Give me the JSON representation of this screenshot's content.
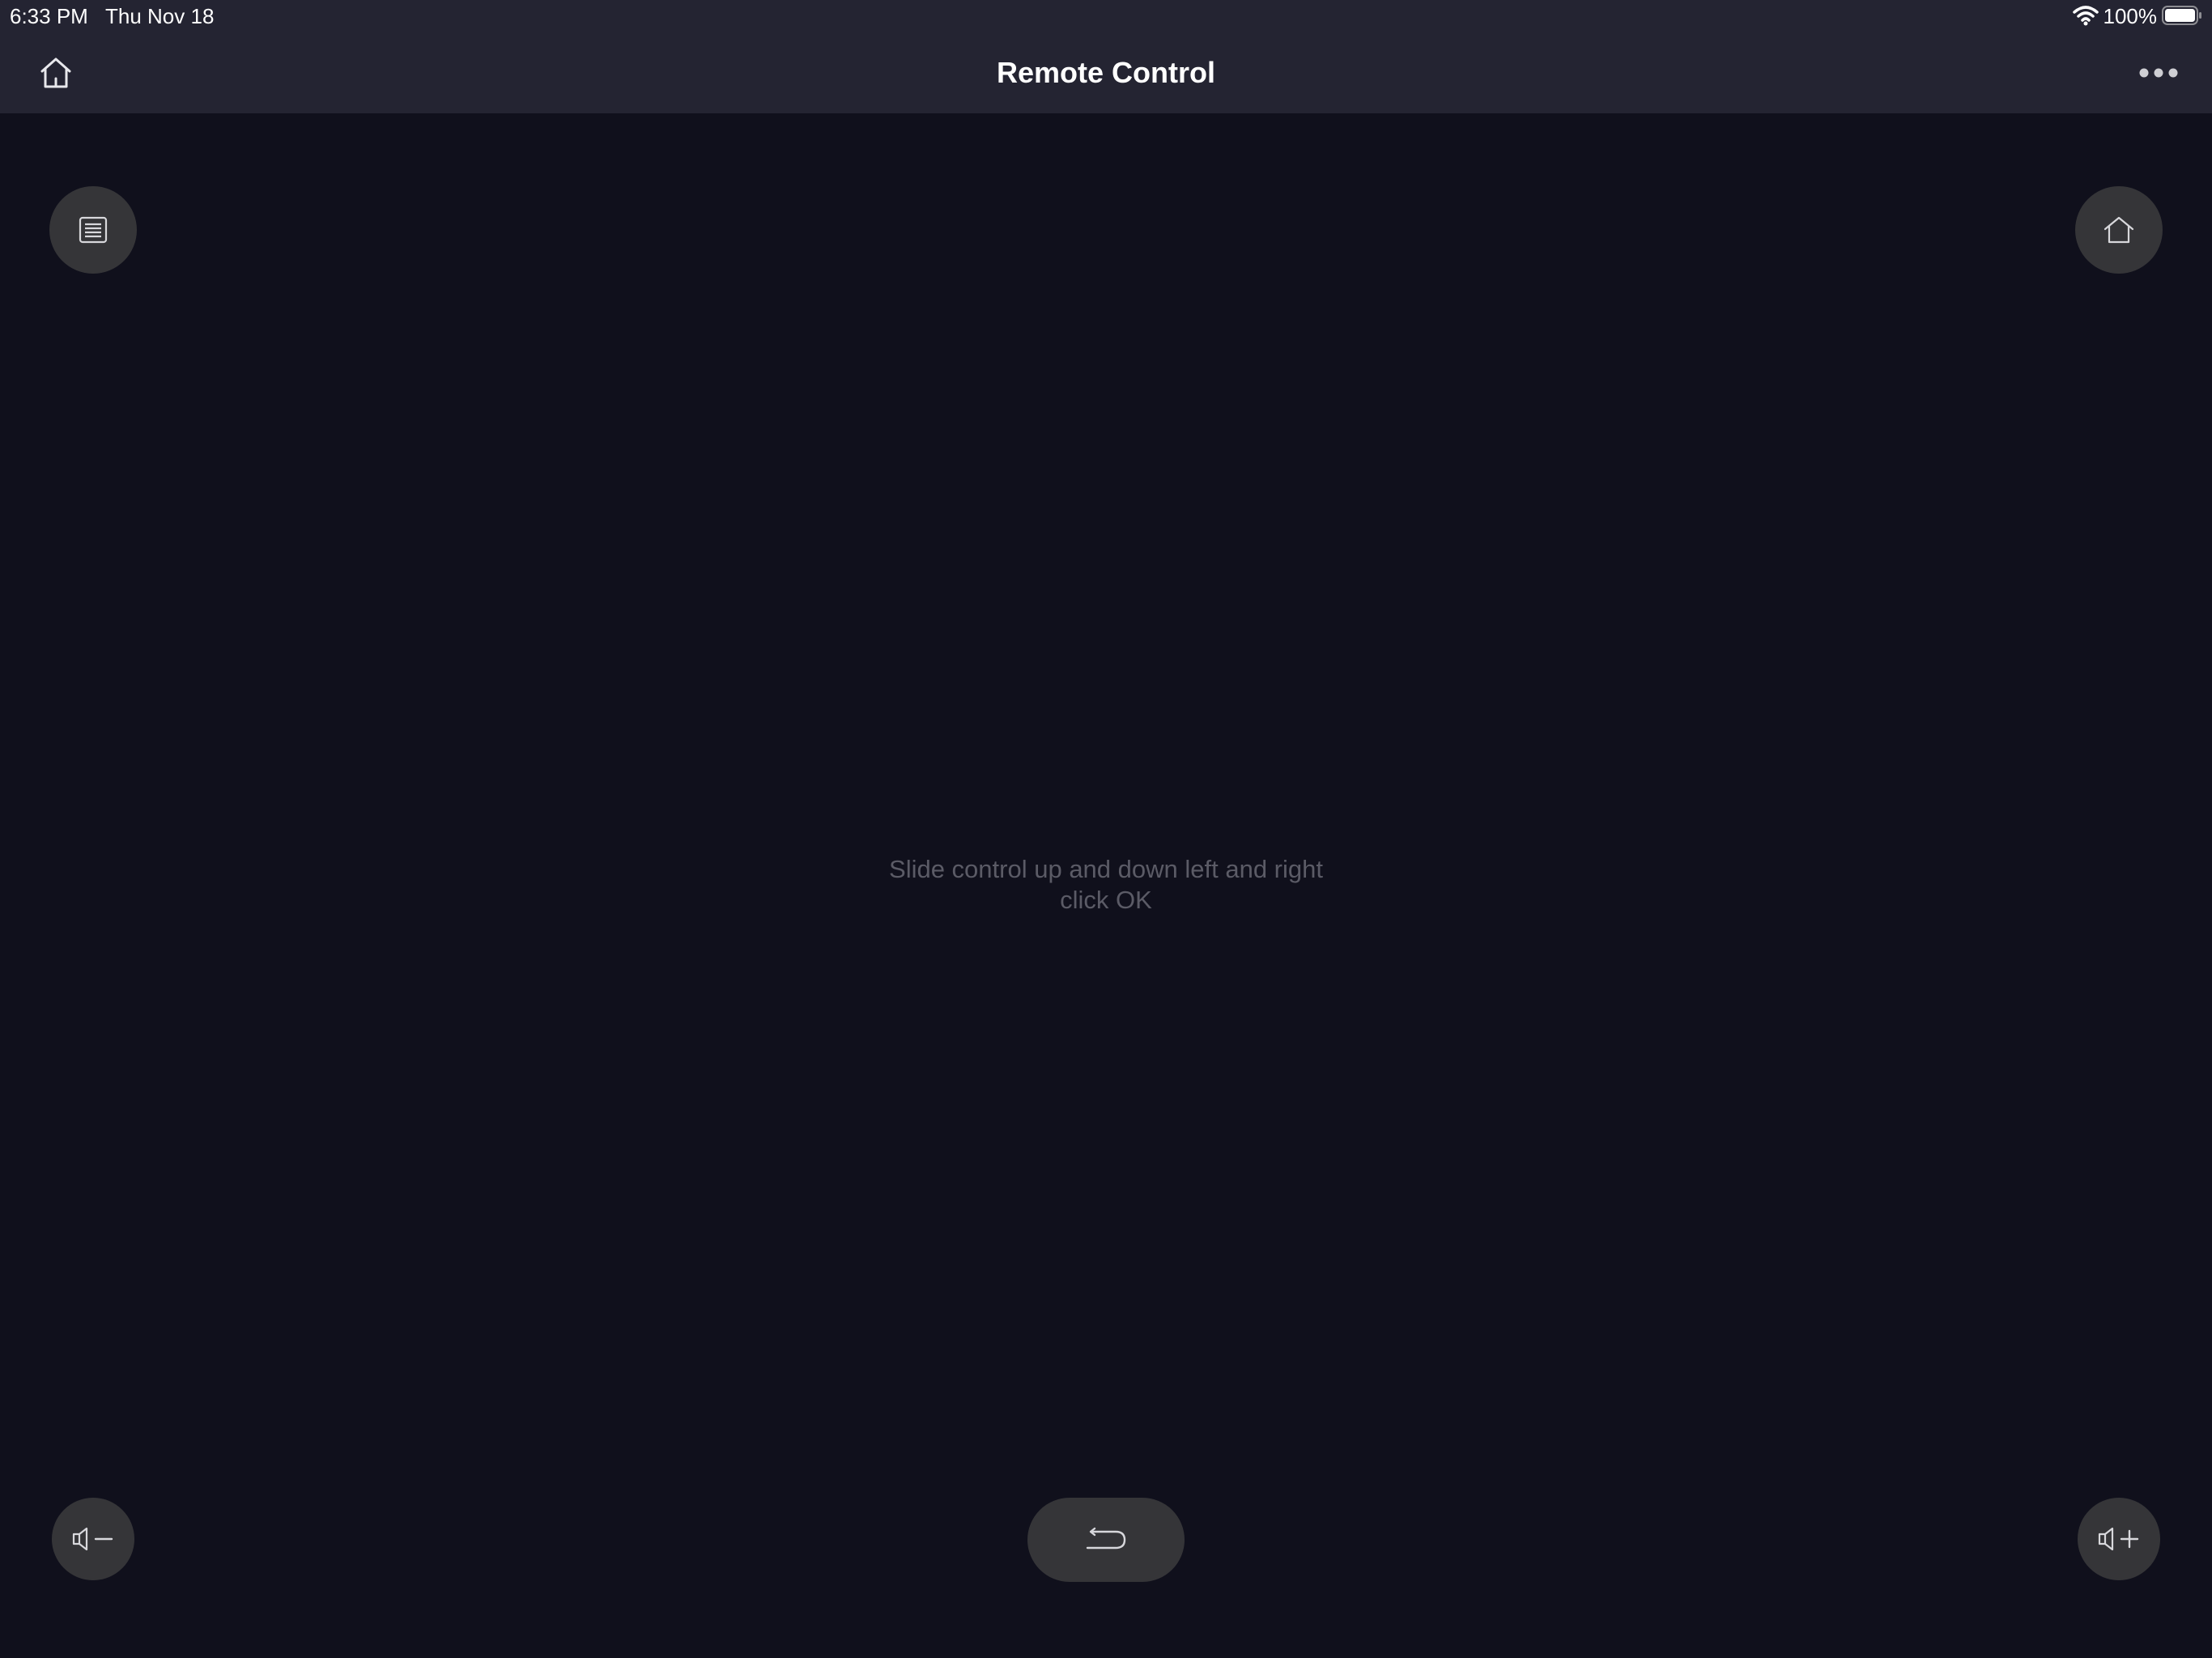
{
  "status_bar": {
    "time": "6:33 PM",
    "date": "Thu Nov 18",
    "battery": "100%",
    "icons": [
      "wifi-icon",
      "battery-icon"
    ]
  },
  "nav_bar": {
    "title": "Remote Control",
    "left_icon": "home-outline-icon",
    "right_icon": "ellipsis-icon"
  },
  "controls": {
    "menu_icon": "list-icon",
    "home_icon": "home-icon",
    "volume_down_icon": "volume-down-icon",
    "volume_up_icon": "volume-up-icon",
    "back_icon": "back-arrow-icon"
  },
  "touchpad": {
    "hint_line1": "Slide control up and down left and right",
    "hint_line2": "click OK"
  },
  "colors": {
    "background": "#10101c",
    "topbar": "#242432",
    "button": "#353538",
    "hint_text": "#5b5b66",
    "icon": "#d8d8dc"
  }
}
